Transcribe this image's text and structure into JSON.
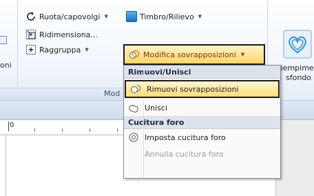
{
  "ribbon": {
    "partial_left_label": "oni",
    "rotate_label": "Ruota/capovolgi",
    "resize_label": "Ridimensiona...",
    "group_label_btn": "Raggruppa",
    "stamp_label": "Timbro/Rilievo",
    "overlap_label": "Modifica sovrapposizioni",
    "fill_label_line1": "Riempime",
    "fill_label_line2": "sfondo",
    "group_caption": "Mod"
  },
  "ruler": {
    "zero_label": "0"
  },
  "menu": {
    "section1": "Rimuovi/Unisci",
    "items1": [
      {
        "label": "Rimuovi sovrapposizioni"
      },
      {
        "label": "Unisci"
      }
    ],
    "section2": "Cucitura foro",
    "items2": [
      {
        "label": "Imposta cucitura foro"
      },
      {
        "label": "Annulla cucitura foro"
      }
    ]
  },
  "colors": {
    "highlight": "#ffd56b",
    "ribbon_bg": "#f3f7fc",
    "accent_blue": "#3a8fd6"
  }
}
